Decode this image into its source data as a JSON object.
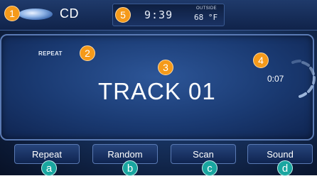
{
  "top_bar": {
    "source": "CD",
    "clock": "9:39",
    "outside_label": "OUTSIDE",
    "outside_temp": "68 °F"
  },
  "display": {
    "repeat_indicator": "REPEAT",
    "track": "TRACK 01",
    "elapsed": "0:07"
  },
  "softkeys": [
    {
      "label": "Repeat"
    },
    {
      "label": "Random"
    },
    {
      "label": "Scan"
    },
    {
      "label": "Sound"
    }
  ],
  "callouts": {
    "numbered": [
      "1",
      "2",
      "3",
      "4",
      "5"
    ],
    "lettered": [
      "a",
      "b",
      "c",
      "d"
    ]
  },
  "colors": {
    "background": "#17325f",
    "accent_callout": "#f59a1a",
    "callout_letter": "#1aa6a0"
  }
}
